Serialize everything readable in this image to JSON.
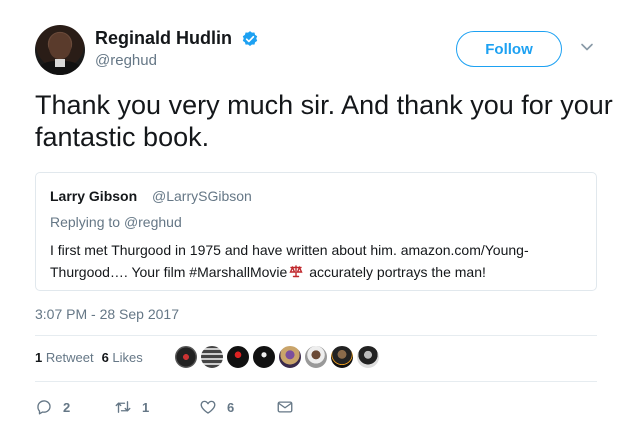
{
  "tweet": {
    "author_name": "Reginald Hudlin",
    "author_handle": "@reghud",
    "follow_label": "Follow",
    "text": "Thank you very much sir.  And thank you for your fantastic book.",
    "timestamp": "3:07 PM - 28 Sep 2017"
  },
  "quote": {
    "name": "Larry Gibson",
    "handle": "@LarrySGibson",
    "replying_prefix": "Replying to ",
    "replying_handle": "@reghud",
    "text_before": "I first met Thurgood in 1975 and have written about him.  amazon.com/Young-Thurgood…. Your film  #MarshallMovie",
    "text_after": " accurately  portrays the man!"
  },
  "stats": {
    "retweets_count": "1",
    "retweets_label": "Retweet",
    "likes_count": "6",
    "likes_label": "Likes"
  },
  "actions": {
    "reply_count": "2",
    "retweet_count": "1",
    "like_count": "6"
  },
  "colors": {
    "accent": "#1da1f2",
    "secondary_text": "#657786",
    "border": "#e1e8ed",
    "hashflag": "#c0282d"
  },
  "icons": {
    "verified": "verified-badge-icon",
    "chevron": "chevron-down-icon",
    "hashflag": "scales-of-justice-icon",
    "reply": "reply-icon",
    "retweet": "retweet-icon",
    "like": "heart-icon",
    "dm": "envelope-icon"
  }
}
